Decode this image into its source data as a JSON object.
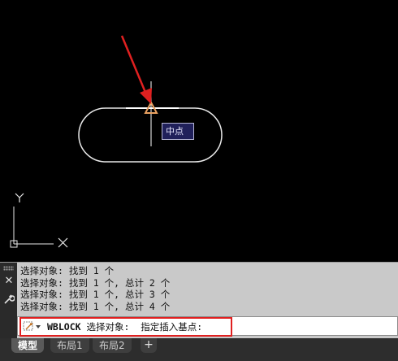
{
  "canvas": {
    "snap_tooltip": "中点",
    "ucs_x_label": "X",
    "ucs_y_label": "Y"
  },
  "command_panel": {
    "history": [
      "选择对象: 找到 1 个",
      "选择对象: 找到 1 个, 总计 2 个",
      "选择对象: 找到 1 个, 总计 3 个",
      "选择对象: 找到 1 个, 总计 4 个"
    ],
    "close_icon": "close-icon",
    "customize_icon": "wrench-icon",
    "command_name": "WBLOCK",
    "prompt_text": " 选择对象:  指定插入基点:",
    "highlight_color": "#e02020"
  },
  "tabs": {
    "items": [
      "模型",
      "布局1",
      "布局2"
    ],
    "active": "模型",
    "add_label": "+"
  },
  "colors": {
    "background": "#000000",
    "geometry": "#ffffff",
    "snap_marker": "#e8a060",
    "arrow": "#e02020"
  }
}
